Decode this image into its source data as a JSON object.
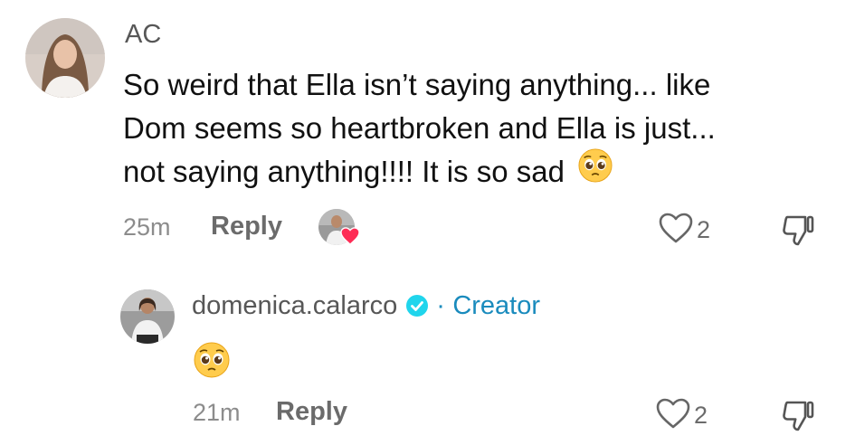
{
  "comment": {
    "username": "AC",
    "text_line1": "So weird that Ella isn’t saying anything... like",
    "text_line2": "Dom seems so heartbroken and Ella is just...",
    "text_line3": "not saying anything!!!! It is so sad",
    "emoji_icon": "pleading-face-emoji",
    "time": "25m",
    "reply_label": "Reply",
    "likes": "2",
    "creator_liked": true
  },
  "reply": {
    "username": "domenica.calarco",
    "verified": true,
    "separator": "·",
    "role": "Creator",
    "emoji_icon": "pleading-face-emoji",
    "time": "21m",
    "reply_label": "Reply",
    "likes": "2"
  },
  "colors": {
    "accent": "#1a8bbd",
    "like_heart": "#fe2c55",
    "muted": "#8c8c8c"
  }
}
